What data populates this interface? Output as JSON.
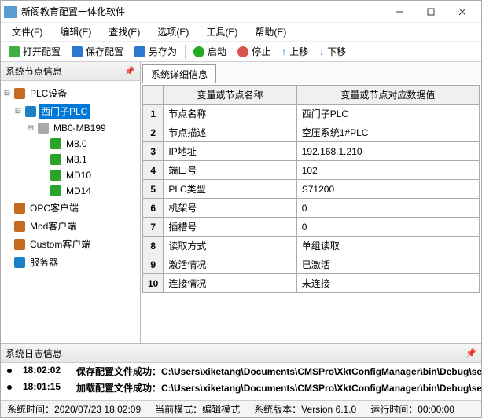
{
  "window": {
    "title": "新阁教育配置一体化软件"
  },
  "menus": {
    "file": "文件(F)",
    "edit": "编辑(E)",
    "find": "查找(E)",
    "option": "选项(E)",
    "tool": "工具(E)",
    "help": "帮助(E)"
  },
  "toolbar": {
    "open": "打开配置",
    "save": "保存配置",
    "saveas": "另存为",
    "start": "启动",
    "stop": "停止",
    "up": "上移",
    "down": "下移"
  },
  "leftPanel": {
    "title": "系统节点信息"
  },
  "tree": {
    "root": "PLC设备",
    "siemens": "西门子PLC",
    "mbrange": "MB0-MB199",
    "leaves": [
      "M8.0",
      "M8.1",
      "MD10",
      "MD14"
    ],
    "opc": "OPC客户端",
    "mod": "Mod客户端",
    "custom": "Custom客户端",
    "server": "服务器"
  },
  "tab": {
    "detail": "系统详细信息"
  },
  "grid": {
    "colName": "变量或节点名称",
    "colValue": "变量或节点对应数据值",
    "rows": [
      {
        "n": "1",
        "name": "节点名称",
        "value": "西门子PLC"
      },
      {
        "n": "2",
        "name": "节点描述",
        "value": "空压系统1#PLC"
      },
      {
        "n": "3",
        "name": "IP地址",
        "value": "192.168.1.210"
      },
      {
        "n": "4",
        "name": "端口号",
        "value": "102"
      },
      {
        "n": "5",
        "name": "PLC类型",
        "value": "S71200"
      },
      {
        "n": "6",
        "name": "机架号",
        "value": "0"
      },
      {
        "n": "7",
        "name": "插槽号",
        "value": "0"
      },
      {
        "n": "8",
        "name": "读取方式",
        "value": "单组读取"
      },
      {
        "n": "9",
        "name": "激活情况",
        "value": "已激活"
      },
      {
        "n": "10",
        "name": "连接情况",
        "value": "未连接"
      }
    ]
  },
  "logPanel": {
    "title": "系统日志信息"
  },
  "logs": [
    {
      "ts": "18:02:02",
      "msg": "保存配置文件成功：C:\\Users\\xiketang\\Documents\\CMSPro\\XktConfigManager\\bin\\Debug\\settings.xml"
    },
    {
      "ts": "18:01:15",
      "msg": "加载配置文件成功：C:\\Users\\xiketang\\Documents\\CMSPro\\XktConfigManager\\bin\\Debug\\settings.xml"
    }
  ],
  "status": {
    "sysTimeLabel": "系统时间：",
    "sysTime": "2020/07/23 18:02:09",
    "modeLabel": "当前模式：",
    "mode": "编辑模式",
    "verLabel": "系统版本：",
    "ver": "Version  6.1.0",
    "runLabel": "运行时间：",
    "run": "00:00:00"
  }
}
